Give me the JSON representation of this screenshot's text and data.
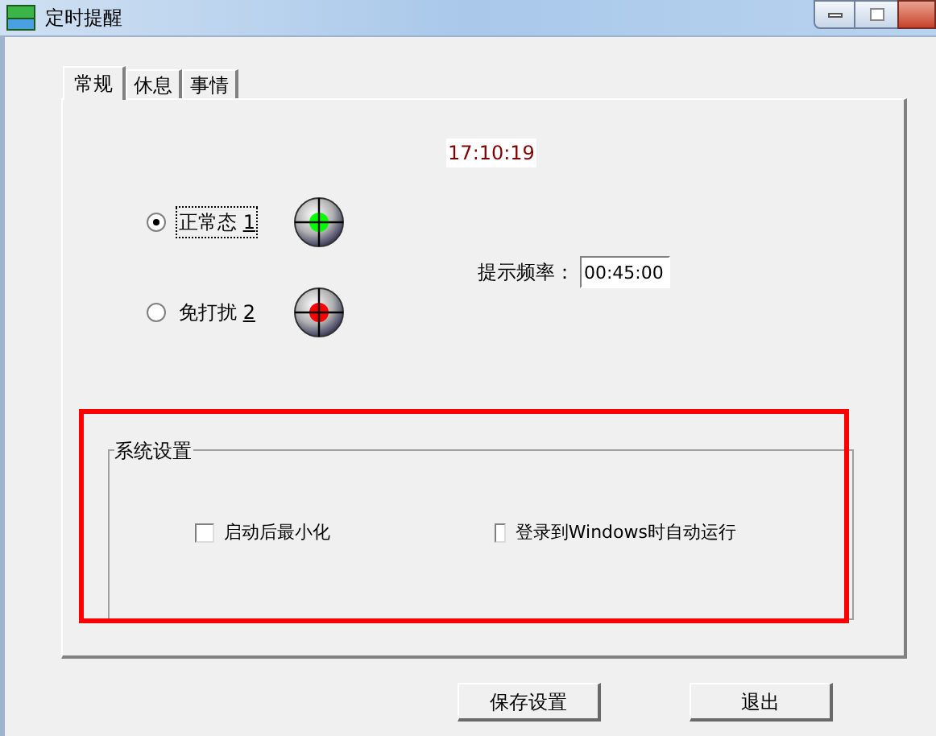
{
  "window": {
    "title": "定时提醒"
  },
  "tabs": [
    {
      "label": "常规",
      "selected": true
    },
    {
      "label": "休息",
      "selected": false
    },
    {
      "label": "事情",
      "selected": false
    }
  ],
  "clock": "17:10:19",
  "modes": [
    {
      "label": "正常态",
      "shortcut": "1",
      "selected": true,
      "color": "#00ff00"
    },
    {
      "label": "免打扰",
      "shortcut": "2",
      "selected": false,
      "color": "#ff0000"
    }
  ],
  "frequency": {
    "label": "提示频率：",
    "value": "00:45:00"
  },
  "system_settings": {
    "title": "系统设置",
    "highlighted": true,
    "options": [
      {
        "label": "启动后最小化",
        "checked": false
      },
      {
        "label": "登录到Windows时自动运行",
        "checked": false
      }
    ]
  },
  "buttons": [
    "保存设置",
    "退出"
  ]
}
